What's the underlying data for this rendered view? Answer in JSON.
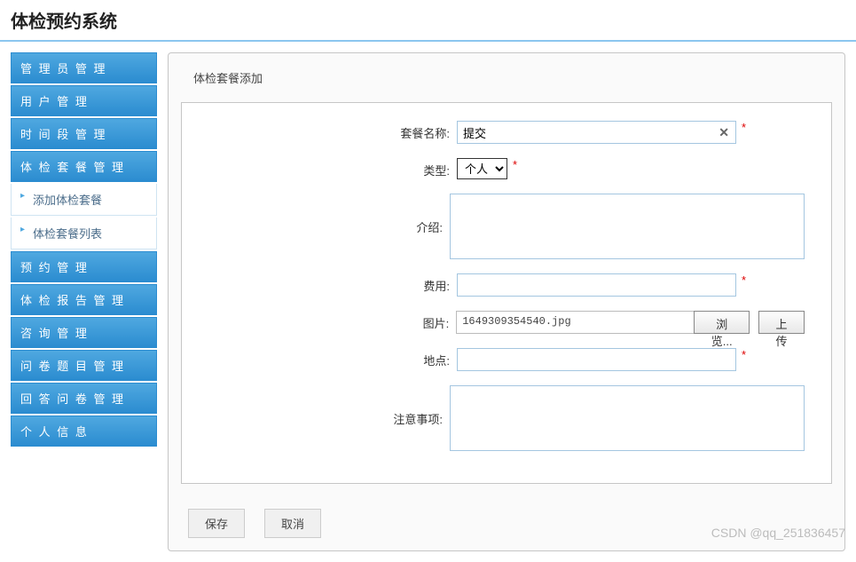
{
  "header": {
    "title": "体检预约系统"
  },
  "sidebar": {
    "items": [
      {
        "label": "管 理 员 管 理"
      },
      {
        "label": "用 户 管 理"
      },
      {
        "label": "时 间 段 管 理"
      },
      {
        "label": "体 检 套 餐 管 理",
        "expanded": true,
        "children": [
          {
            "label": "添加体检套餐"
          },
          {
            "label": "体检套餐列表"
          }
        ]
      },
      {
        "label": "预 约 管 理"
      },
      {
        "label": "体 检 报 告 管 理"
      },
      {
        "label": "咨 询 管 理"
      },
      {
        "label": "问 卷 题 目 管 理"
      },
      {
        "label": "回 答 问 卷 管 理"
      },
      {
        "label": "个 人 信 息"
      }
    ]
  },
  "panel": {
    "title": "体检套餐添加"
  },
  "form": {
    "name": {
      "label": "套餐名称:",
      "value": "提交"
    },
    "type": {
      "label": "类型:",
      "selected": "个人",
      "options": [
        "个人"
      ]
    },
    "intro": {
      "label": "介绍:",
      "value": ""
    },
    "fee": {
      "label": "费用:",
      "value": ""
    },
    "image": {
      "label": "图片:",
      "filename": "1649309354540.jpg",
      "browse_label": "浏览...",
      "upload_label": "上传"
    },
    "location": {
      "label": "地点:",
      "value": ""
    },
    "notes": {
      "label": "注意事项:",
      "value": ""
    }
  },
  "actions": {
    "save_label": "保存",
    "cancel_label": "取消"
  },
  "watermark": "CSDN @qq_251836457",
  "required_mark": "*"
}
